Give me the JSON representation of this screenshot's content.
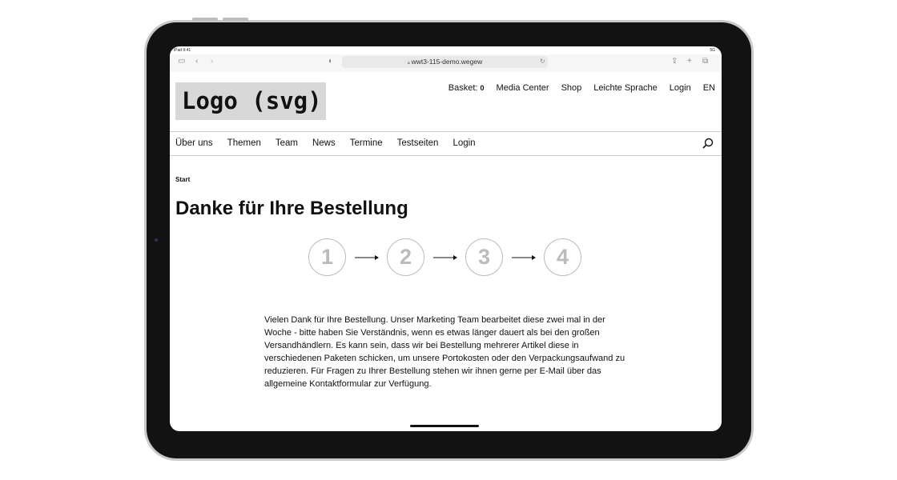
{
  "status": {
    "device": "iPad 9:41",
    "signal": "5G"
  },
  "browser": {
    "url": "wwt3-115-demo.wegew"
  },
  "header": {
    "logo": "Logo (svg)",
    "basket_label": "Basket:",
    "basket_count": "0",
    "links": [
      "Media Center",
      "Shop",
      "Leichte Sprache",
      "Login",
      "EN"
    ]
  },
  "nav": {
    "items": [
      "Über uns",
      "Themen",
      "Team",
      "News",
      "Termine",
      "Testseiten",
      "Login"
    ]
  },
  "breadcrumb": "Start",
  "page": {
    "title": "Danke für Ihre Bestellung",
    "steps": [
      "1",
      "2",
      "3",
      "4"
    ],
    "text": "Vielen Dank für Ihre Bestellung. Unser Marketing Team bearbeitet diese zwei mal in der Woche - bitte haben Sie Verständnis, wenn es etwas länger dauert als bei den großen Versandhändlern. Es kann sein, dass wir bei Bestellung mehrerer Artikel diese in verschiedenen Paketen schicken, um unsere Portokosten oder den Verpackungsaufwand zu reduzieren. Für Fragen zu Ihrer Bestellung stehen wir ihnen gerne per E-Mail über das allgemeine Kontaktformular zur Verfügung."
  }
}
